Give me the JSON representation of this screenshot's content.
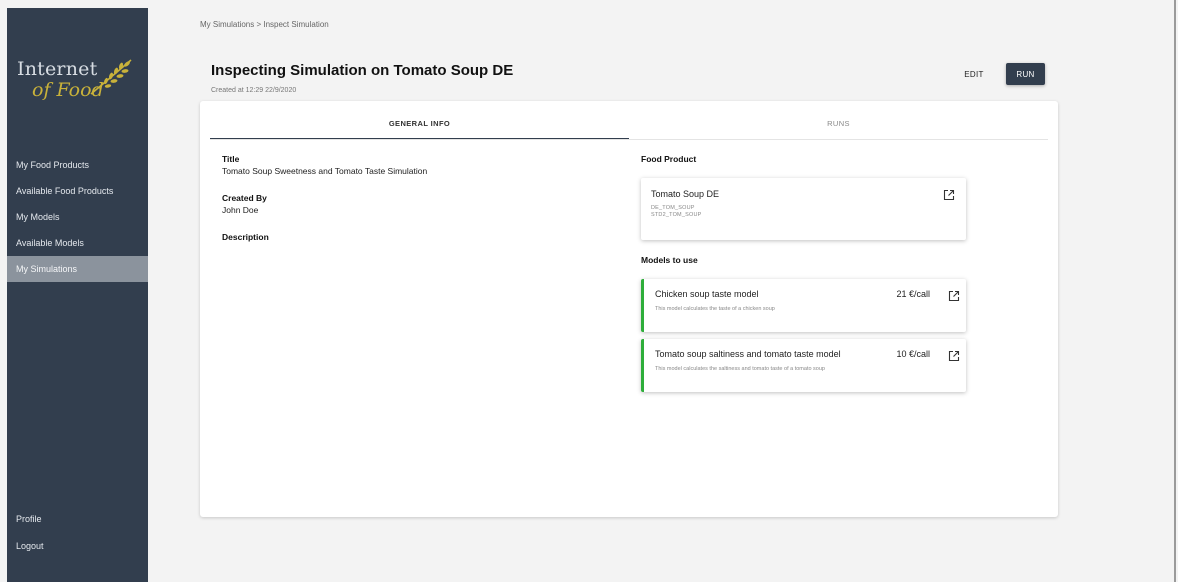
{
  "sidebar": {
    "logo": {
      "line1": "Internet",
      "line2": "of Food"
    },
    "items": [
      {
        "label": "My Food Products"
      },
      {
        "label": "Available Food Products"
      },
      {
        "label": "My Models"
      },
      {
        "label": "Available Models"
      },
      {
        "label": "My Simulations"
      }
    ],
    "bottom_items": [
      {
        "label": "Profile"
      },
      {
        "label": "Logout"
      }
    ]
  },
  "header": {
    "breadcrumb": "My Simulations > Inspect Simulation",
    "title": "Inspecting Simulation on Tomato Soup DE",
    "created_at": "Created at 12:29 22/9/2020",
    "edit_label": "EDIT",
    "run_label": "RUN"
  },
  "tabs": [
    {
      "label": "GENERAL INFO",
      "active": true
    },
    {
      "label": "RUNS",
      "active": false
    }
  ],
  "general_info": {
    "title_label": "Title",
    "title_value": "Tomato Soup Sweetness and Tomato Taste Simulation",
    "created_by_label": "Created By",
    "created_by_value": "John Doe",
    "description_label": "Description"
  },
  "food_product": {
    "section_title": "Food Product",
    "name": "Tomato Soup DE",
    "codes": [
      "DE_TOM_SOUP",
      "STD2_TOM_SOUP"
    ]
  },
  "models": {
    "section_title": "Models to use",
    "items": [
      {
        "name": "Chicken soup taste model",
        "description": "This model calculates the taste of a chicken soup",
        "price": "21 €/call"
      },
      {
        "name": "Tomato soup saltiness and tomato taste model",
        "description": "This model calculates the saltiness and tomato taste of a tomato soup",
        "price": "10 €/call"
      }
    ]
  },
  "colors": {
    "sidebar_bg": "#323e4e",
    "active_nav_bg": "#8b939d",
    "model_accent": "#2eae3a",
    "run_button_bg": "#323e4e"
  },
  "icons": [
    "wheat-logo-icon",
    "external-link-icon"
  ]
}
